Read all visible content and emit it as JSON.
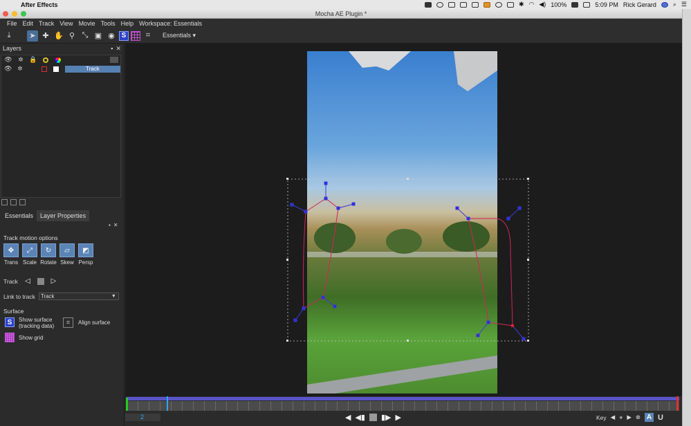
{
  "mac_menu": {
    "app_name": "After Effects",
    "battery": "100%",
    "time": "5:09 PM",
    "user": "Rick Gerard"
  },
  "window": {
    "title": "Mocha AE Plugin *"
  },
  "menu": [
    "File",
    "Edit",
    "Track",
    "View",
    "Movie",
    "Tools",
    "Help",
    "Workspace: Essentials"
  ],
  "toolbar": {
    "workspace_dropdown": "Essentials"
  },
  "layers_panel": {
    "title": "Layers",
    "layers": [
      {
        "name": "Track"
      }
    ]
  },
  "tabs": [
    {
      "label": "Essentials"
    },
    {
      "label": "Layer Properties"
    }
  ],
  "essentials": {
    "track_motion_title": "Track motion options",
    "motion_options": [
      {
        "label": "Trans",
        "icon": "translation-icon"
      },
      {
        "label": "Scale",
        "icon": "scale-icon"
      },
      {
        "label": "Rotate",
        "icon": "rotate-icon"
      },
      {
        "label": "Skew",
        "icon": "skew-icon"
      },
      {
        "label": "Persp",
        "icon": "perspective-icon"
      }
    ],
    "track_label": "Track",
    "link_to_track_label": "Link to track",
    "link_to_track_value": "Track",
    "surface_title": "Surface",
    "show_surface_label_1": "Show surface",
    "show_surface_label_2": "(tracking data)",
    "align_surface_label": "Align surface",
    "show_grid_label": "Show grid"
  },
  "timeline": {
    "current_frame": "2",
    "key_label": "Key"
  },
  "colors": {
    "accent": "#5681b2",
    "spline": "#d0245a",
    "track_point": "#2a2ae0",
    "timeline_bar": "#5a54c9",
    "playhead": "#2aa8ff"
  }
}
